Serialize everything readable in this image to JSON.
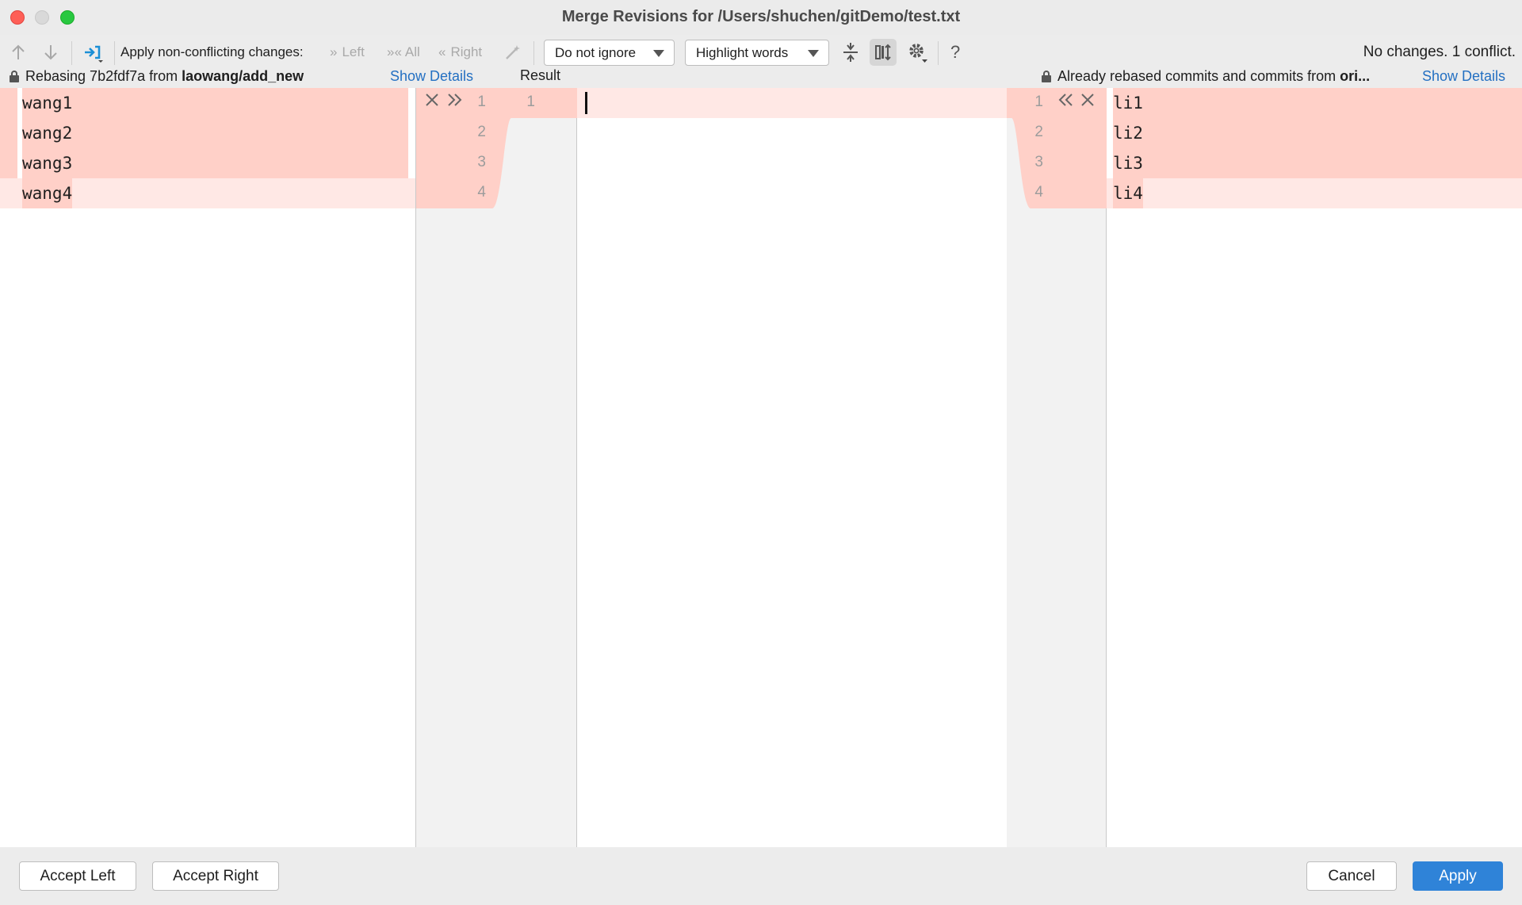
{
  "window": {
    "title": "Merge Revisions for /Users/shuchen/gitDemo/test.txt"
  },
  "toolbar": {
    "apply_label": "Apply non-conflicting changes:",
    "left_label": "Left",
    "all_label": "All",
    "right_label": "Right",
    "ignore_select": "Do not ignore",
    "highlight_select": "Highlight words",
    "help_label": "?",
    "status": "No changes. 1 conflict."
  },
  "info": {
    "left_prefix": "Rebasing 7b2fdf7a from ",
    "left_branch": "laowang/add_new",
    "left_details": "Show Details",
    "result_label": "Result",
    "right_prefix": "Already rebased commits and commits from ",
    "right_branch": "ori...",
    "right_details": "Show Details"
  },
  "left": {
    "lines": [
      "wang1",
      "wang2",
      "wang3",
      "wang4"
    ],
    "line_numbers": [
      "1",
      "2",
      "3",
      "4"
    ]
  },
  "result": {
    "line_numbers": [
      "1"
    ]
  },
  "right": {
    "lines": [
      "li1",
      "li2",
      "li3",
      "li4"
    ],
    "line_numbers": [
      "1",
      "2",
      "3",
      "4"
    ]
  },
  "footer": {
    "accept_left": "Accept Left",
    "accept_right": "Accept Right",
    "cancel": "Cancel",
    "apply": "Apply"
  },
  "colors": {
    "conflict": "#ffd0c8",
    "conflict_light": "#ffe8e5",
    "accent": "#2f83d8",
    "link": "#2470c2"
  }
}
